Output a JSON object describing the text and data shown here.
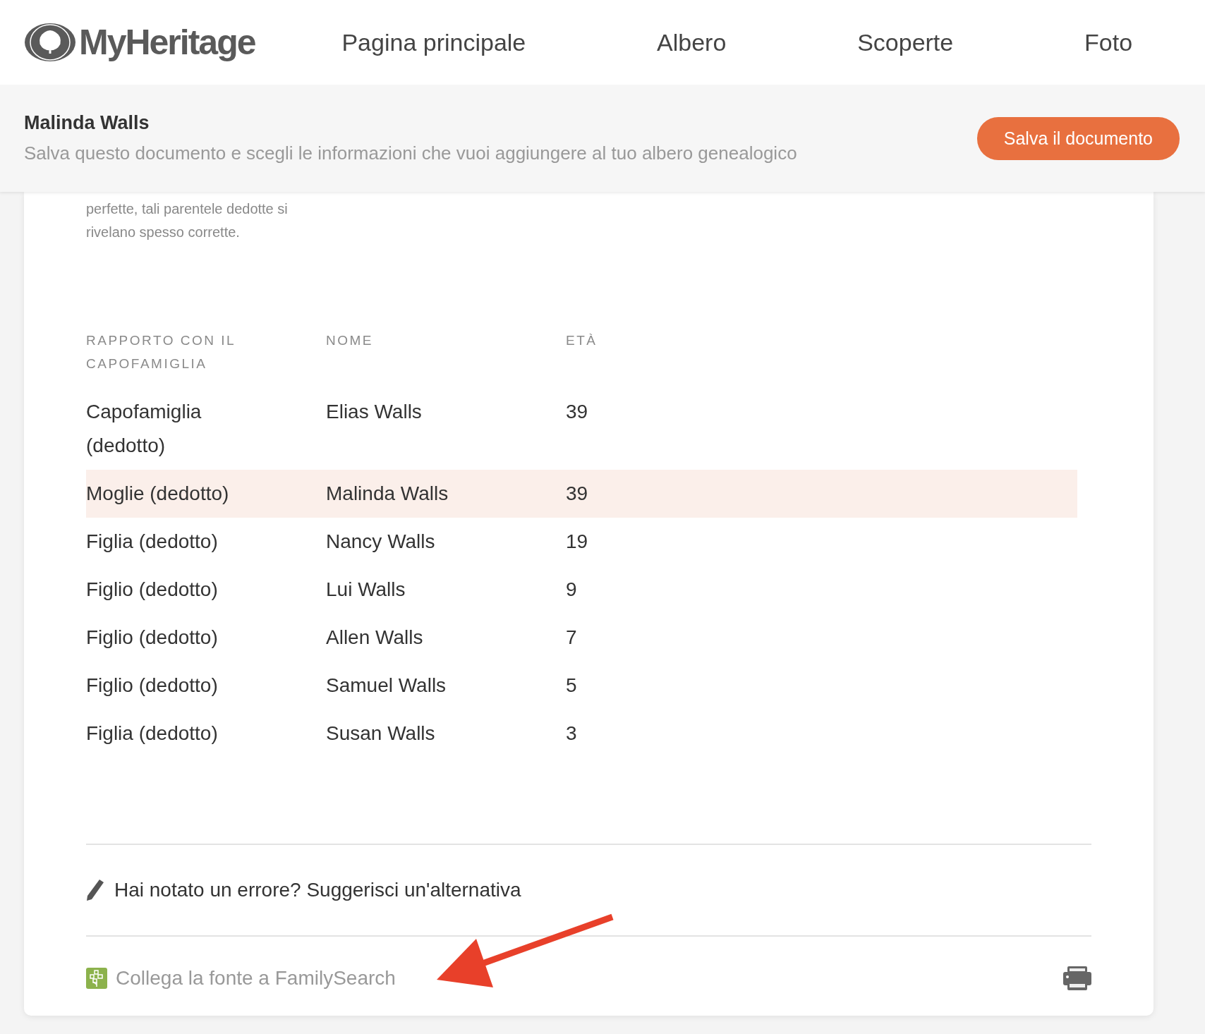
{
  "header": {
    "logo": "MyHeritage",
    "nav": [
      "Pagina principale",
      "Albero",
      "Scoperte",
      "Foto"
    ]
  },
  "document_bar": {
    "title": "Malinda Walls",
    "subtitle": "Salva questo documento e scegli le informazioni che vuoi aggiungere al tuo albero genealogico",
    "button": "Salva il documento"
  },
  "intro": "perfette, tali parentele dedotte si rivelano spesso corrette.",
  "table": {
    "columns": [
      "RAPPORTO CON IL CAPOFAMIGLIA",
      "NOME",
      "ETÀ"
    ],
    "rows": [
      {
        "cells": [
          "Capofamiglia (dedotto)",
          "Elias Walls",
          "39"
        ],
        "highlighted": false
      },
      {
        "cells": [
          "Moglie (dedotto)",
          "Malinda Walls",
          "39"
        ],
        "highlighted": true
      },
      {
        "cells": [
          "Figlia (dedotto)",
          "Nancy Walls",
          "19"
        ],
        "highlighted": false
      },
      {
        "cells": [
          "Figlio (dedotto)",
          "Lui Walls",
          "9"
        ],
        "highlighted": false
      },
      {
        "cells": [
          "Figlio (dedotto)",
          "Allen Walls",
          "7"
        ],
        "highlighted": false
      },
      {
        "cells": [
          "Figlio (dedotto)",
          "Samuel Walls",
          "5"
        ],
        "highlighted": false
      },
      {
        "cells": [
          "Figlia (dedotto)",
          "Susan Walls",
          "3"
        ],
        "highlighted": false
      }
    ]
  },
  "suggest_link": "Hai notato un errore? Suggerisci un'alternativa",
  "familysearch_link": "Collega la fonte a FamilySearch"
}
